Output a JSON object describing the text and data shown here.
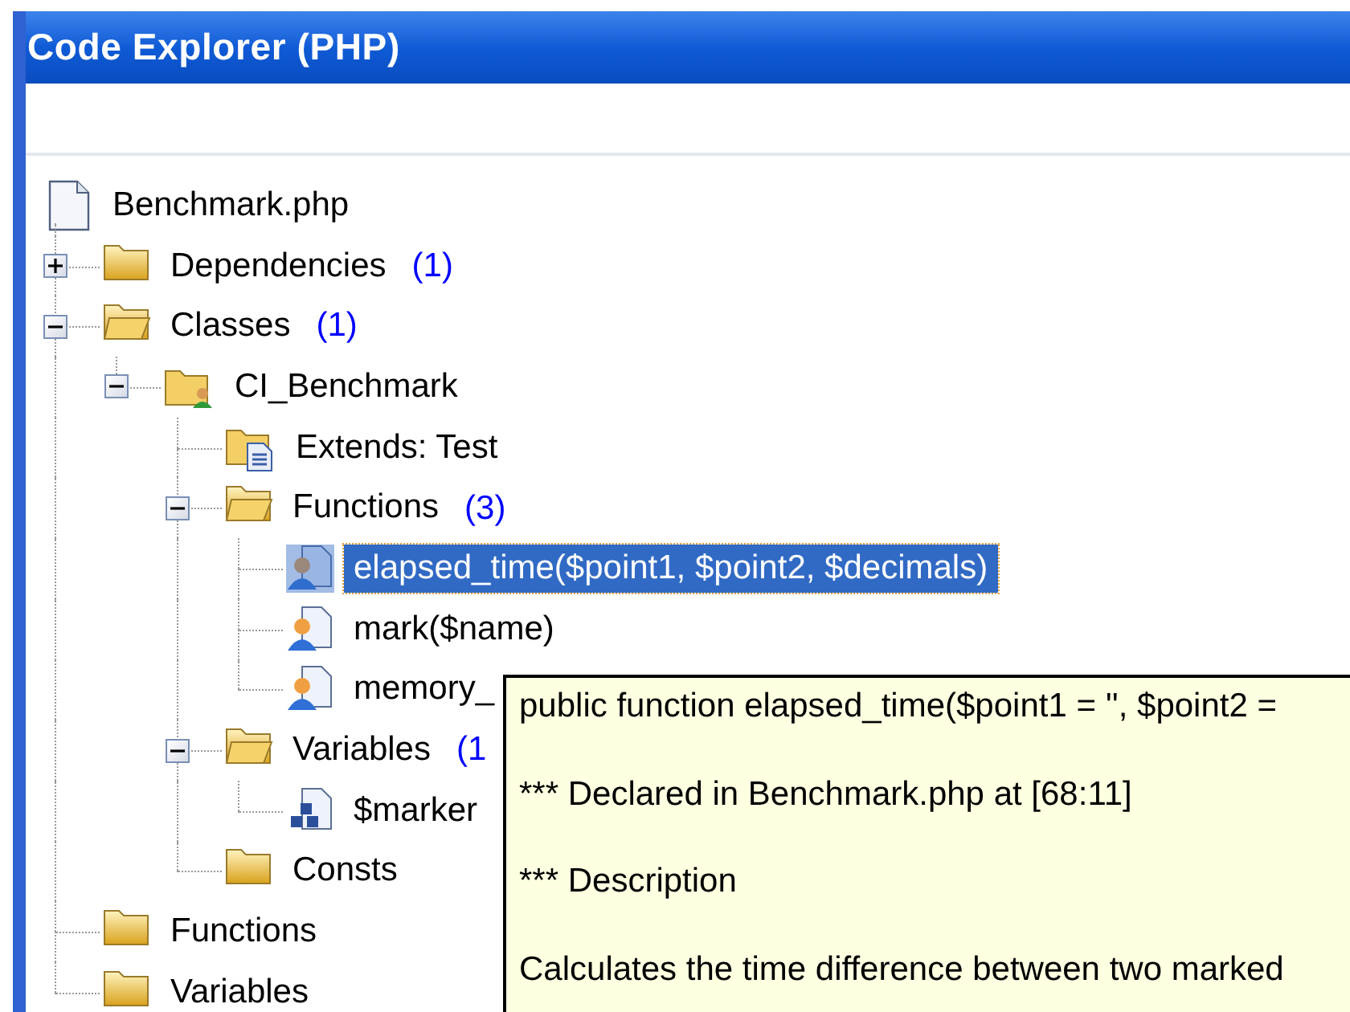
{
  "window": {
    "title": "Code Explorer (PHP)"
  },
  "tree": {
    "label": "Benchmark.php",
    "kind": "file",
    "selected": false,
    "children": [
      {
        "label": "Dependencies",
        "count": "(1)",
        "kind": "folder",
        "expanded": false,
        "selected": false
      },
      {
        "label": "Classes",
        "count": "(1)",
        "kind": "folder-open",
        "expanded": true,
        "selected": false,
        "children": [
          {
            "label": "CI_Benchmark",
            "kind": "class",
            "expanded": true,
            "selected": false,
            "children": [
              {
                "label": "Extends: Test",
                "kind": "extends",
                "selected": false
              },
              {
                "label": "Functions",
                "count": "(3)",
                "kind": "folder-open",
                "expanded": true,
                "selected": false,
                "children": [
                  {
                    "label": "elapsed_time($point1, $point2, $decimals)",
                    "kind": "function",
                    "selected": true
                  },
                  {
                    "label": "mark($name)",
                    "kind": "function",
                    "selected": false
                  },
                  {
                    "label": "memory_",
                    "kind": "function",
                    "selected": false
                  }
                ]
              },
              {
                "label": "Variables",
                "count": "(1",
                "kind": "folder-open",
                "expanded": true,
                "selected": false,
                "children": [
                  {
                    "label": "$marker",
                    "kind": "variable",
                    "selected": false
                  }
                ]
              },
              {
                "label": "Consts",
                "kind": "folder",
                "selected": false
              }
            ]
          }
        ]
      },
      {
        "label": "Functions",
        "kind": "folder",
        "selected": false
      },
      {
        "label": "Variables",
        "kind": "folder",
        "selected": false
      }
    ]
  },
  "tooltip": {
    "lines": [
      "public function elapsed_time($point1 = '', $point2 =",
      "*** Declared in Benchmark.php at [68:11]",
      "*** Description",
      "Calculates the time difference between two marked"
    ]
  }
}
